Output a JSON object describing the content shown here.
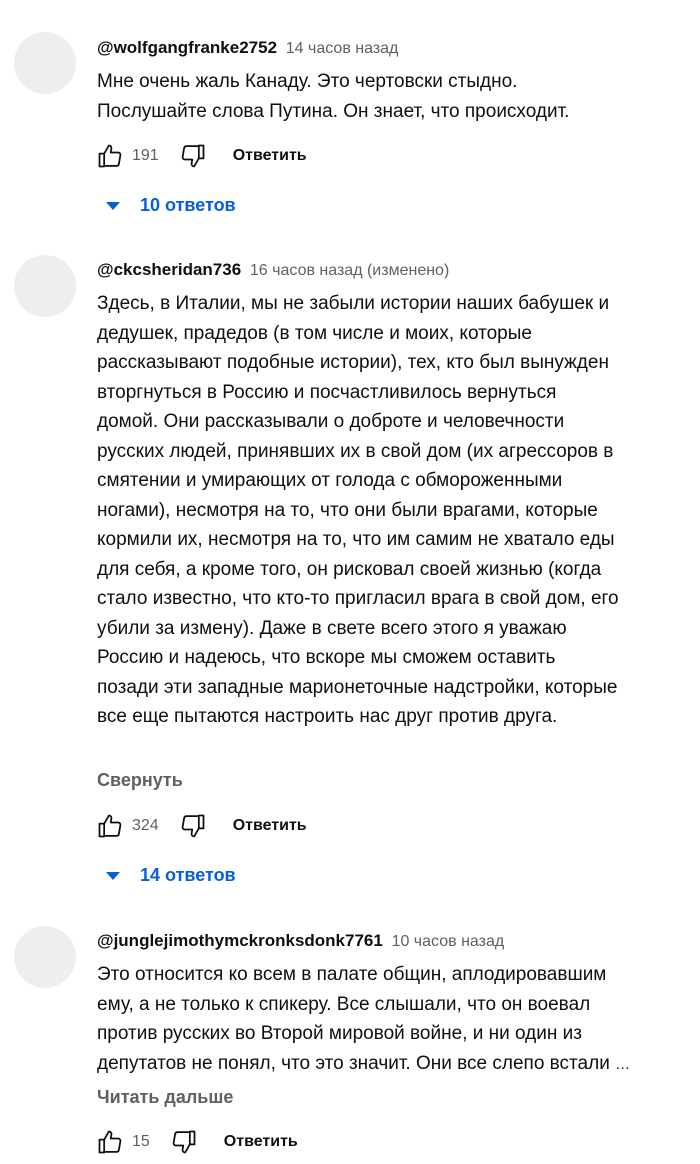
{
  "comments": [
    {
      "author": "@wolfgangfranke2752",
      "time": "14 часов назад",
      "lines": [
        "Мне очень жаль Канаду. Это чертовски стыдно.",
        "Послушайте слова Путина. Он знает, что происходит."
      ],
      "likes": "191",
      "reply_label": "Ответить",
      "replies_label": "10 ответов"
    },
    {
      "author": "@ckcsheridan736",
      "time": "16 часов назад (изменено)",
      "lines": [
        "Здесь, в Италии, мы не забыли истории наших бабушек и",
        "дедушек, прадедов (в том числе и моих, которые",
        "рассказывают подобные истории), тех, кто был вынужден",
        "вторгнуться в Россию и посчастливилось вернуться",
        "домой.  Они рассказывали о доброте и человечности",
        "русских людей, принявших их в свой дом (их агрессоров в",
        "смятении и умирающих от голода с обмороженными",
        "ногами), несмотря на то, что они были врагами, которые",
        "кормили их, несмотря на то, что им самим не хватало еды",
        "для себя, а кроме того, он рисковал своей жизнью (когда",
        "стало известно, что кто-то пригласил врага в свой дом, его",
        "убили за измену).  Даже в свете всего этого я уважаю",
        "Россию и надеюсь, что вскоре мы сможем оставить",
        "позади эти западные марионеточные надстройки, которые",
        "все еще пытаются настроить нас друг против друга."
      ],
      "more_label": "Свернуть",
      "likes": "324",
      "reply_label": "Ответить",
      "replies_label": "14 ответов"
    },
    {
      "author": "@junglejimothymckronksdonk7761",
      "time": "10 часов назад",
      "lines": [
        "Это относится ко всем в палате общин, аплодировавшим",
        "ему, а не только к спикеру. Все слышали, что он воевал",
        "против русских во Второй мировой войне, и ни один из",
        "депутатов не понял, что это значит. Они все слепо встали"
      ],
      "ellipsis": "…",
      "more_label": "Читать дальше",
      "likes": "15",
      "reply_label": "Ответить"
    }
  ]
}
